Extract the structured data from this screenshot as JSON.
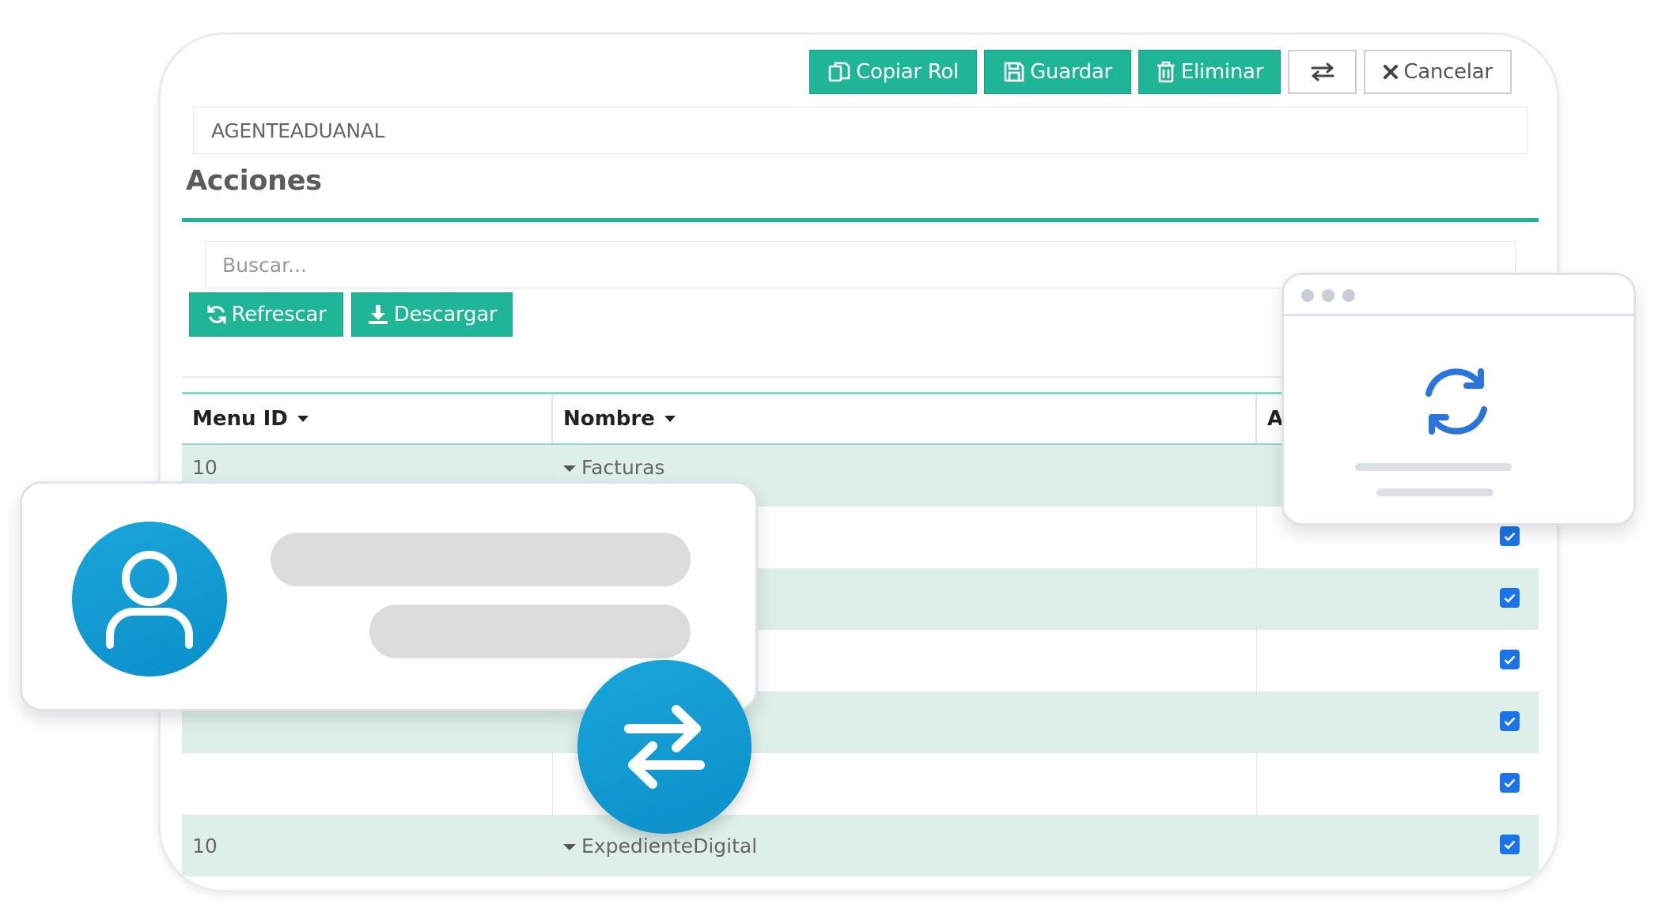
{
  "toolbar": {
    "copy_label": "Copiar Rol",
    "save_label": "Guardar",
    "delete_label": "Eliminar",
    "cancel_label": "Cancelar"
  },
  "role": {
    "value": "AGENTEADUANAL"
  },
  "section": {
    "title": "Acciones"
  },
  "search": {
    "placeholder": "Buscar..."
  },
  "actions": {
    "refresh_label": "Refrescar",
    "download_label": "Descargar"
  },
  "table": {
    "columns": [
      "Menu ID",
      "Nombre",
      "A"
    ],
    "rows": [
      {
        "menu_id": "10",
        "nombre": "Facturas",
        "checked": true
      },
      {
        "menu_id": "",
        "nombre": "",
        "checked": true
      },
      {
        "menu_id": "",
        "nombre": "",
        "checked": true
      },
      {
        "menu_id": "",
        "nombre": "",
        "checked": true
      },
      {
        "menu_id": "",
        "nombre": "",
        "checked": true
      },
      {
        "menu_id": "",
        "nombre": "",
        "checked": true
      },
      {
        "menu_id": "10",
        "nombre": "ExpedienteDigital",
        "checked": true
      }
    ]
  },
  "colors": {
    "accent": "#1fb597",
    "row_alt": "#ddefe8",
    "checkbox": "#1a73e8",
    "icon_blue": "#0b8fca"
  },
  "icons": {
    "copy": "copy-icon",
    "save": "floppy-disk-icon",
    "delete": "trash-icon",
    "swap": "swap-arrows-icon",
    "cancel": "close-icon",
    "refresh": "refresh-icon",
    "download": "download-icon",
    "user": "user-icon",
    "sync": "sync-icon"
  }
}
